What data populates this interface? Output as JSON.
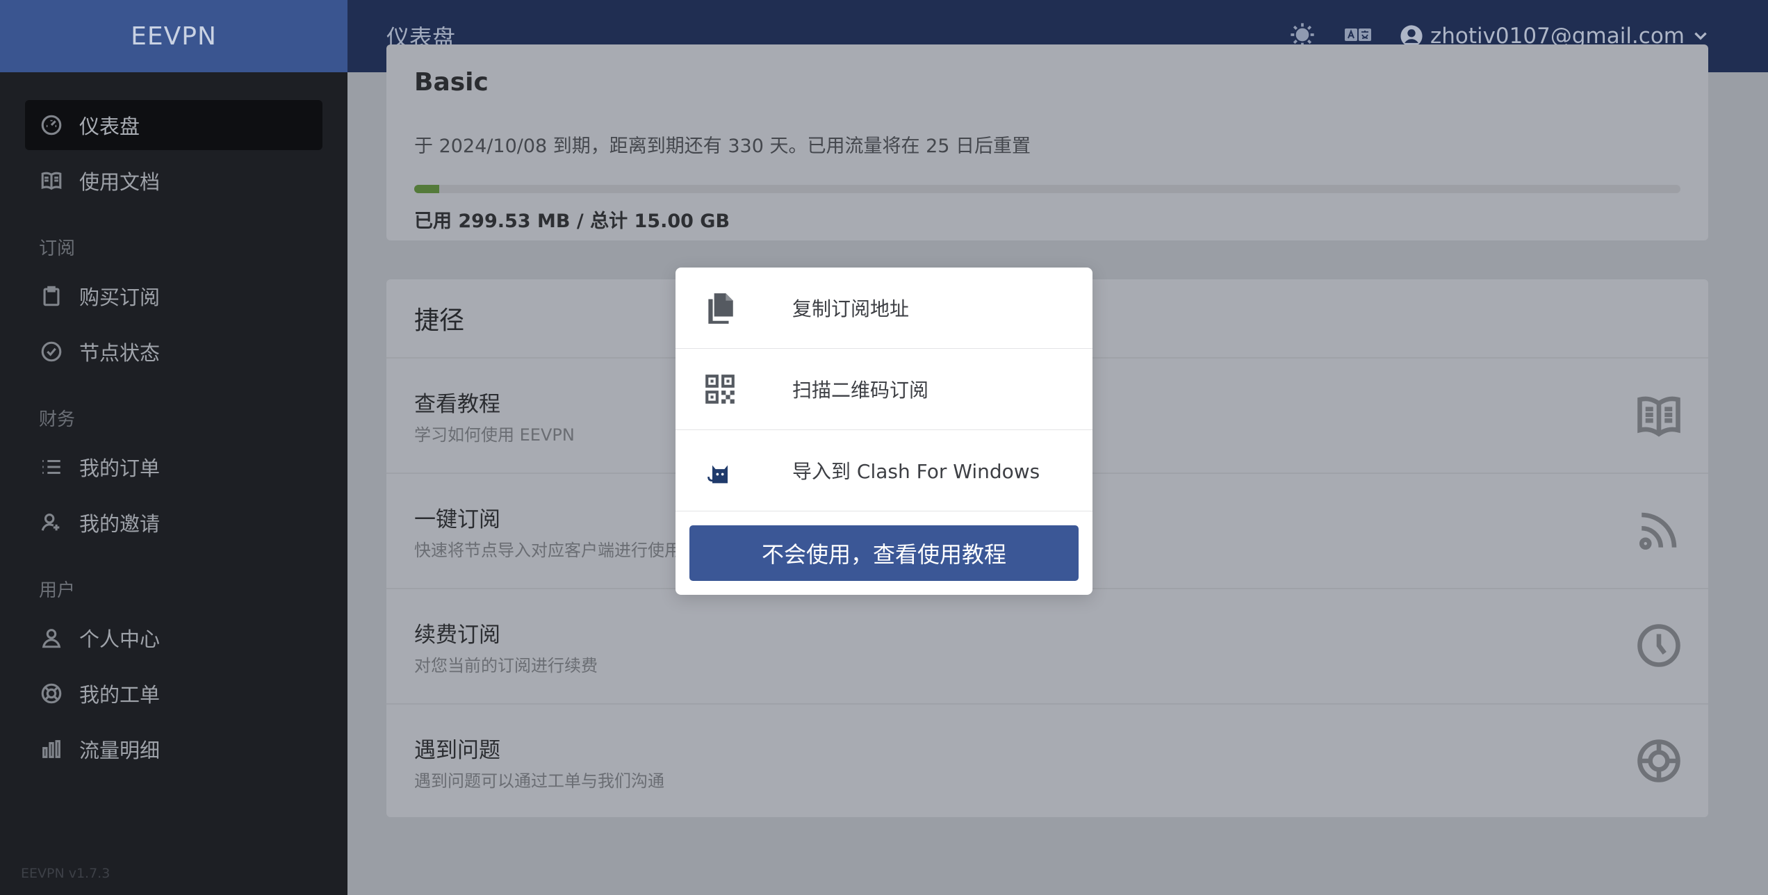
{
  "app": {
    "brand": "EEVPN",
    "version": "EEVPN v1.7.3"
  },
  "topbar": {
    "page_title": "仪表盘",
    "user_email": "zhotiv0107@gmail.com"
  },
  "sidebar": {
    "items_top": [
      {
        "label": "仪表盘",
        "icon": "dashboard-icon",
        "active": true
      },
      {
        "label": "使用文档",
        "icon": "book-icon"
      }
    ],
    "groups": [
      {
        "title": "订阅",
        "items": [
          {
            "label": "购买订阅",
            "icon": "clipboard-icon"
          },
          {
            "label": "节点状态",
            "icon": "check-circle-icon"
          }
        ]
      },
      {
        "title": "财务",
        "items": [
          {
            "label": "我的订单",
            "icon": "list-icon"
          },
          {
            "label": "我的邀请",
            "icon": "user-plus-icon"
          }
        ]
      },
      {
        "title": "用户",
        "items": [
          {
            "label": "个人中心",
            "icon": "user-icon"
          },
          {
            "label": "我的工单",
            "icon": "lifebuoy-icon"
          },
          {
            "label": "流量明细",
            "icon": "bar-chart-icon"
          }
        ]
      }
    ]
  },
  "subscription": {
    "plan": "Basic",
    "info": "于 2024/10/08 到期，距离到期还有 330 天。已用流量将在 25 日后重置",
    "usage_text": "已用 299.53 MB / 总计 15.00 GB",
    "usage_fraction": 0.0195
  },
  "shortcuts": {
    "title": "捷径",
    "items": [
      {
        "title": "查看教程",
        "desc": "学习如何使用 EEVPN",
        "icon": "book-open-icon"
      },
      {
        "title": "一键订阅",
        "desc": "快速将节点导入对应客户端进行使用",
        "icon": "rss-icon"
      },
      {
        "title": "续费订阅",
        "desc": "对您当前的订阅进行续费",
        "icon": "clock-icon"
      },
      {
        "title": "遇到问题",
        "desc": "遇到问题可以通过工单与我们沟通",
        "icon": "lifebuoy-icon"
      }
    ]
  },
  "modal": {
    "items": [
      {
        "label": "复制订阅地址",
        "icon": "copy-icon"
      },
      {
        "label": "扫描二维码订阅",
        "icon": "qrcode-icon"
      },
      {
        "label": "导入到 Clash For Windows",
        "icon": "clash-cat-icon"
      }
    ],
    "button": "不会使用，查看使用教程"
  },
  "colors": {
    "brand": "#3b5796",
    "sidebar": "#1d1f24",
    "topbar": "#202e52",
    "progress": "#5b8f3c"
  }
}
